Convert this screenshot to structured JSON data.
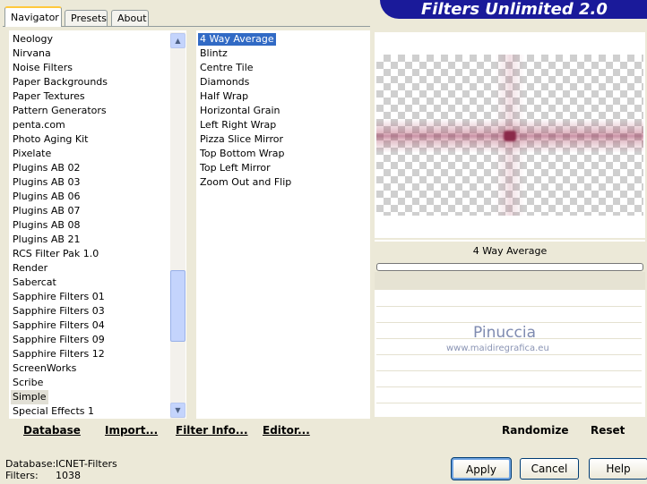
{
  "window": {
    "title": "Filters Unlimited 2.0"
  },
  "tabs": [
    {
      "label": "Navigator"
    },
    {
      "label": "Presets"
    },
    {
      "label": "About"
    }
  ],
  "categories": [
    "Neology",
    "Nirvana",
    "Noise Filters",
    "Paper Backgrounds",
    "Paper Textures",
    "Pattern Generators",
    "penta.com",
    "Photo Aging Kit",
    "Pixelate",
    "Plugins AB 02",
    "Plugins AB 03",
    "Plugins AB 06",
    "Plugins AB 07",
    "Plugins AB 08",
    "Plugins AB 21",
    "RCS Filter Pak 1.0",
    "Render",
    "Sabercat",
    "Sapphire Filters 01",
    "Sapphire Filters 03",
    "Sapphire Filters 04",
    "Sapphire Filters 09",
    "Sapphire Filters 12",
    "ScreenWorks",
    "Scribe",
    "Simple",
    "Special Effects 1"
  ],
  "selected_category": "Simple",
  "filters": [
    "4 Way Average",
    "Blintz",
    "Centre Tile",
    "Diamonds",
    "Half Wrap",
    "Horizontal Grain",
    "Left Right Wrap",
    "Pizza Slice Mirror",
    "Top Bottom Wrap",
    "Top Left Mirror",
    "Zoom Out and Flip"
  ],
  "selected_filter": "4 Way Average",
  "left_buttons": {
    "database": "Database",
    "import": "Import...",
    "filter_info": "Filter Info...",
    "editor": "Editor..."
  },
  "preview": {
    "filter_name": "4 Way Average",
    "watermark": "Pinuccia",
    "watermark_url": "www.maidiregrafica.eu"
  },
  "right_buttons": {
    "randomize": "Randomize",
    "reset": "Reset"
  },
  "status": {
    "database_label": "Database:",
    "database_value": "ICNET-Filters",
    "filters_label": "Filters:",
    "filters_value": "1038"
  },
  "dialog_buttons": {
    "apply": "Apply",
    "cancel": "Cancel",
    "help": "Help"
  },
  "colors": {
    "banner": "#1a1a9a",
    "selection": "#316ac5",
    "accent_preview": "#8a2a4a"
  }
}
